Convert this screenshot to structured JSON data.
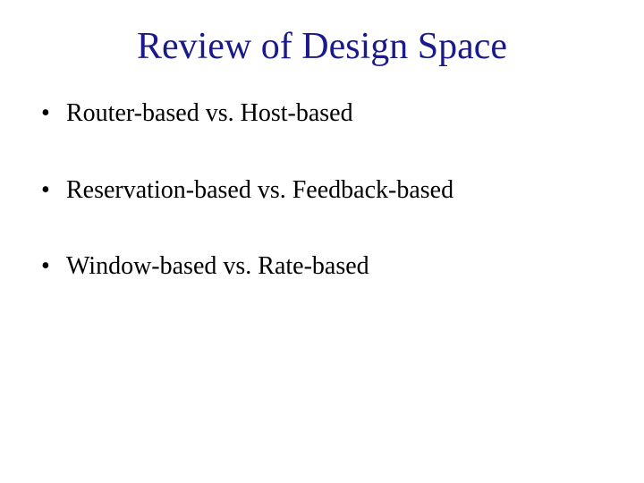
{
  "title": "Review of Design Space",
  "bullets": [
    "Router-based vs. Host-based",
    "Reservation-based vs. Feedback-based",
    "Window-based vs. Rate-based"
  ]
}
